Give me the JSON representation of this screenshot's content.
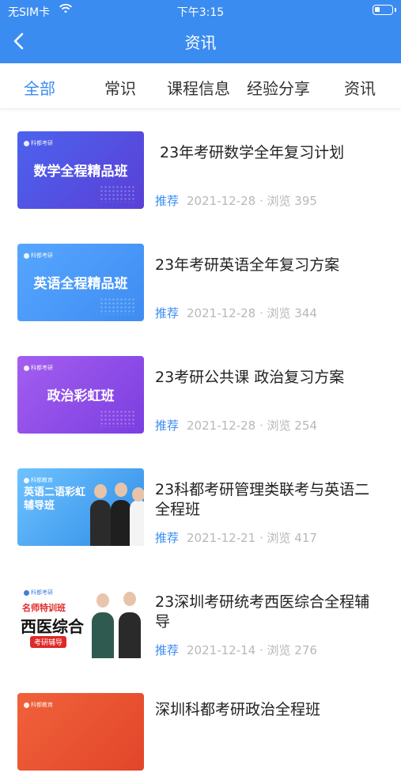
{
  "status_bar": {
    "carrier": "无SIM卡",
    "time": "下午3:15"
  },
  "nav": {
    "title": "资讯"
  },
  "tabs": [
    {
      "label": "全部"
    },
    {
      "label": "常识"
    },
    {
      "label": "课程信息"
    },
    {
      "label": "经验分享"
    },
    {
      "label": "资讯"
    }
  ],
  "articles": [
    {
      "thumb_text": "数学全程精品班",
      "thumb_brand": "科都考研",
      "title": "23年考研数学全年复习计划",
      "tag": "推荐",
      "date": "2021-12-28",
      "views": "浏览 395"
    },
    {
      "thumb_text": "英语全程精品班",
      "thumb_brand": "科都考研",
      "title": "23年考研英语全年复习方案",
      "tag": "推荐",
      "date": "2021-12-28",
      "views": "浏览 344"
    },
    {
      "thumb_text": "政治彩虹班",
      "thumb_brand": "科都考研",
      "title": "23考研公共课 政治复习方案",
      "tag": "推荐",
      "date": "2021-12-28",
      "views": "浏览 254"
    },
    {
      "thumb_text": "英语二语彩虹辅导班",
      "thumb_brand": "科都教育",
      "title": "23科都考研管理类联考与英语二全程班",
      "tag": "推荐",
      "date": "2021-12-21",
      "views": "浏览 417"
    },
    {
      "thumb_text": "西医综合",
      "thumb_sub": "名师特训班",
      "thumb_badge": "考研辅导",
      "thumb_brand": "科都考研",
      "title": "23深圳考研统考西医综合全程辅导",
      "tag": "推荐",
      "date": "2021-12-14",
      "views": "浏览 276"
    },
    {
      "thumb_brand": "科都教育",
      "title": "深圳科都考研政治全程班"
    }
  ],
  "colors": {
    "accent": "#3b8cf0",
    "tag": "#3b8cf0",
    "meta": "#b8b8b8"
  },
  "icons": {
    "back": "chevron-left-icon",
    "wifi": "wifi-icon",
    "battery": "battery-icon"
  }
}
